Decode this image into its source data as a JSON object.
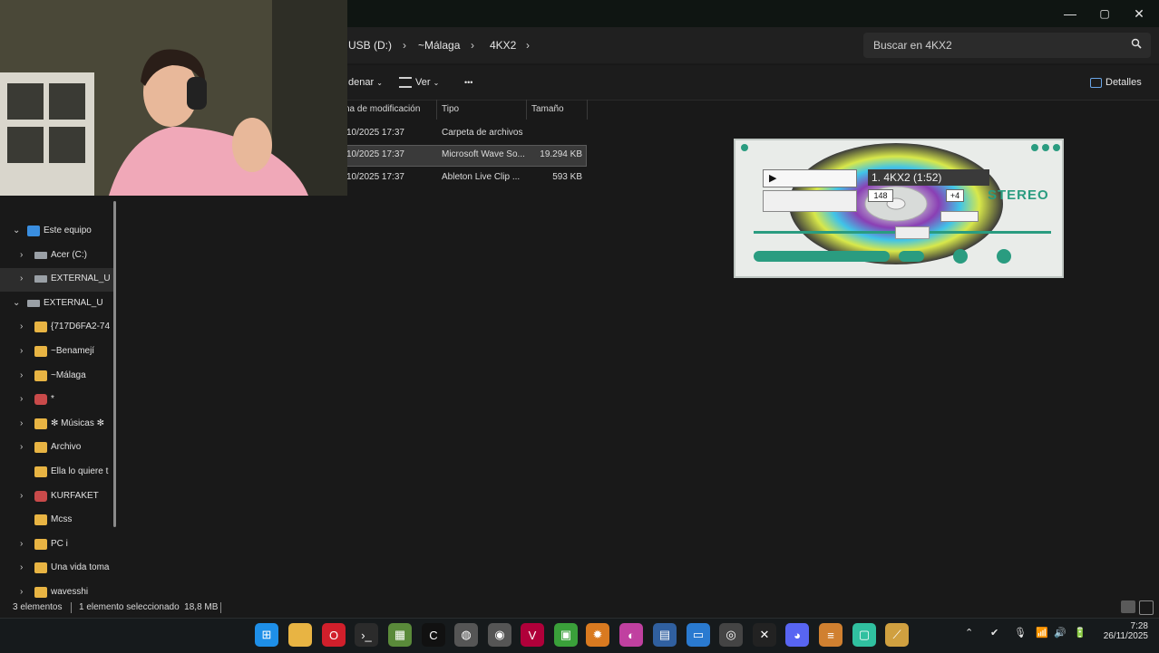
{
  "window": {
    "minimize_glyph": "—",
    "maximize_glyph": "▢",
    "close_glyph": "✕"
  },
  "breadcrumb": [
    {
      "label": "USB (D:)"
    },
    {
      "label": "~Málaga"
    },
    {
      "label": "4KX2"
    }
  ],
  "breadcrumb_sep": "›",
  "search": {
    "placeholder": "Buscar en 4KX2"
  },
  "commands": {
    "sort": "denar",
    "view": "Ver",
    "more": "•••",
    "details": "Detalles"
  },
  "columns": {
    "modified": "na de modificación",
    "type": "Tipo",
    "size": "Tamaño"
  },
  "files": [
    {
      "modified": "10/2025 17:37",
      "type": "Carpeta de archivos",
      "size": ""
    },
    {
      "modified": "10/2025 17:37",
      "type": "Microsoft Wave So...",
      "size": "19.294 KB"
    },
    {
      "modified": "10/2025 17:37",
      "type": "Ableton Live Clip ...",
      "size": "593 KB"
    }
  ],
  "sidebar": [
    {
      "label": "Este equipo",
      "level": 0,
      "expanded": true,
      "icon": "computer-icon"
    },
    {
      "label": "Acer (C:)",
      "level": 1,
      "icon": "drive-icon"
    },
    {
      "label": "EXTERNAL_USB",
      "level": 1,
      "icon": "usb-drive-icon",
      "selected": true
    },
    {
      "label": "EXTERNAL_USB",
      "level": 0,
      "expanded": true,
      "icon": "usb-drive-icon"
    },
    {
      "label": "{717D6FA2-74",
      "level": 1,
      "icon": "folder-icon"
    },
    {
      "label": "~Benamejí",
      "level": 1,
      "icon": "folder-icon"
    },
    {
      "label": "~Málaga",
      "level": 1,
      "icon": "folder-icon"
    },
    {
      "label": "*",
      "level": 1,
      "icon": "app-icon"
    },
    {
      "label": "✻ Músicas ✻",
      "level": 1,
      "icon": "folder-icon"
    },
    {
      "label": "Archivo",
      "level": 1,
      "icon": "folder-icon"
    },
    {
      "label": "Ella lo quiere t",
      "level": 1,
      "icon": "folder-icon",
      "nochev": true
    },
    {
      "label": "KURFAKET",
      "level": 1,
      "icon": "app-icon"
    },
    {
      "label": "Mcss",
      "level": 1,
      "icon": "folder-icon",
      "nochev": true
    },
    {
      "label": "PC i",
      "level": 1,
      "icon": "folder-icon"
    },
    {
      "label": "Una vida toma",
      "level": 1,
      "icon": "folder-icon"
    },
    {
      "label": "wavesshi",
      "level": 1,
      "icon": "folder-icon"
    }
  ],
  "status": {
    "count": "3 elementos",
    "selected": "1 elemento seleccionado  18,8 MB"
  },
  "player": {
    "track": "1. 4KX2 (1:52)",
    "elapsed": "148",
    "volume": "+4",
    "stereo": "STEREO"
  },
  "clock": {
    "time": "7:28",
    "date": "26/11/2025"
  },
  "colors": {
    "accent": "#1e6fd0",
    "folder": "#e8b443",
    "player_teal": "#2a9c80"
  }
}
